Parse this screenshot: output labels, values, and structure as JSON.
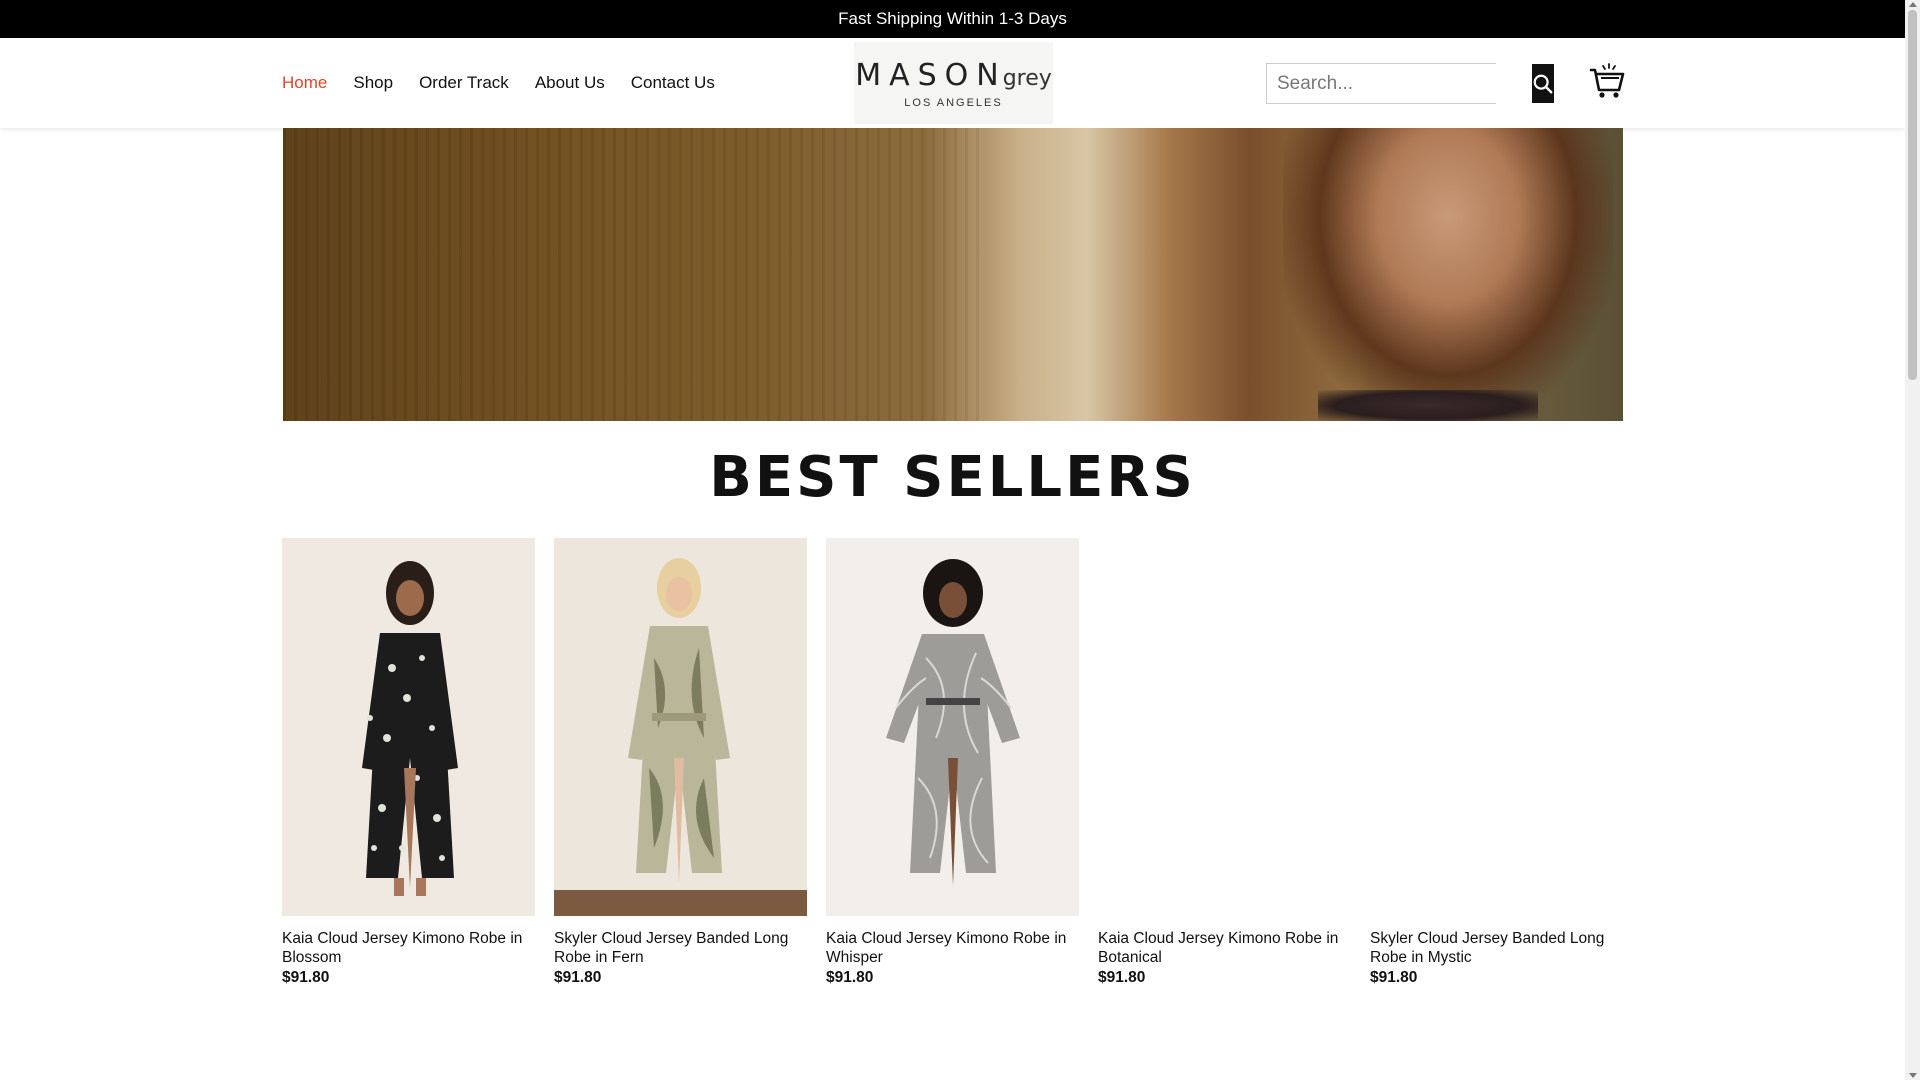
{
  "announcement": {
    "text": "Fast Shipping Within 1-3 Days"
  },
  "nav": {
    "items": [
      {
        "label": "Home",
        "active": true
      },
      {
        "label": "Shop"
      },
      {
        "label": "Order Track"
      },
      {
        "label": "About Us"
      },
      {
        "label": "Contact Us"
      }
    ]
  },
  "logo": {
    "brand": "MASON",
    "brand_suffix": "grey",
    "city": "LOS ANGELES"
  },
  "search": {
    "placeholder": "Search...",
    "icon": "search-icon"
  },
  "cart": {
    "icon": "cart-icon"
  },
  "section": {
    "title": "BEST SELLERS"
  },
  "products": [
    {
      "name": "Kaia Cloud Jersey Kimono Robe in Blossom",
      "price": "$91.80"
    },
    {
      "name": "Skyler Cloud Jersey Banded Long Robe in Fern",
      "price": "$91.80"
    },
    {
      "name": "Kaia Cloud Jersey Kimono Robe in Whisper",
      "price": "$91.80"
    },
    {
      "name": "Kaia Cloud Jersey Kimono Robe in Botanical",
      "price": "$91.80"
    },
    {
      "name": "Skyler Cloud Jersey Banded Long Robe in Mystic",
      "price": "$91.80"
    }
  ],
  "colors": {
    "accent": "#e0452a",
    "topbar": "#000000"
  }
}
